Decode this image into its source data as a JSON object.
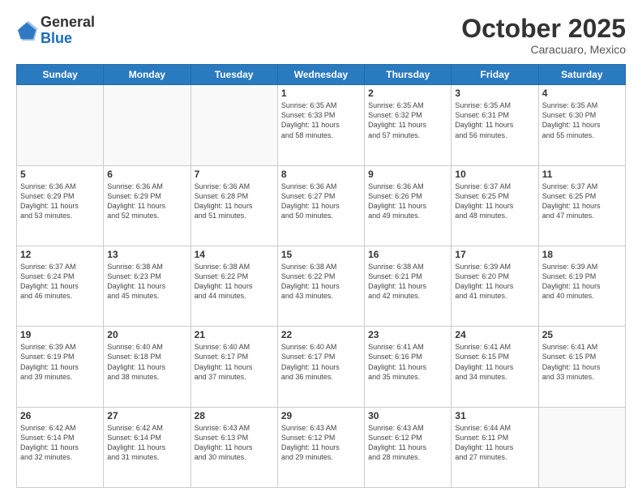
{
  "header": {
    "logo_general": "General",
    "logo_blue": "Blue",
    "month": "October 2025",
    "location": "Caracuaro, Mexico"
  },
  "days_of_week": [
    "Sunday",
    "Monday",
    "Tuesday",
    "Wednesday",
    "Thursday",
    "Friday",
    "Saturday"
  ],
  "weeks": [
    [
      {
        "day": "",
        "info": ""
      },
      {
        "day": "",
        "info": ""
      },
      {
        "day": "",
        "info": ""
      },
      {
        "day": "1",
        "info": "Sunrise: 6:35 AM\nSunset: 6:33 PM\nDaylight: 11 hours\nand 58 minutes."
      },
      {
        "day": "2",
        "info": "Sunrise: 6:35 AM\nSunset: 6:32 PM\nDaylight: 11 hours\nand 57 minutes."
      },
      {
        "day": "3",
        "info": "Sunrise: 6:35 AM\nSunset: 6:31 PM\nDaylight: 11 hours\nand 56 minutes."
      },
      {
        "day": "4",
        "info": "Sunrise: 6:35 AM\nSunset: 6:30 PM\nDaylight: 11 hours\nand 55 minutes."
      }
    ],
    [
      {
        "day": "5",
        "info": "Sunrise: 6:36 AM\nSunset: 6:29 PM\nDaylight: 11 hours\nand 53 minutes."
      },
      {
        "day": "6",
        "info": "Sunrise: 6:36 AM\nSunset: 6:29 PM\nDaylight: 11 hours\nand 52 minutes."
      },
      {
        "day": "7",
        "info": "Sunrise: 6:36 AM\nSunset: 6:28 PM\nDaylight: 11 hours\nand 51 minutes."
      },
      {
        "day": "8",
        "info": "Sunrise: 6:36 AM\nSunset: 6:27 PM\nDaylight: 11 hours\nand 50 minutes."
      },
      {
        "day": "9",
        "info": "Sunrise: 6:36 AM\nSunset: 6:26 PM\nDaylight: 11 hours\nand 49 minutes."
      },
      {
        "day": "10",
        "info": "Sunrise: 6:37 AM\nSunset: 6:25 PM\nDaylight: 11 hours\nand 48 minutes."
      },
      {
        "day": "11",
        "info": "Sunrise: 6:37 AM\nSunset: 6:25 PM\nDaylight: 11 hours\nand 47 minutes."
      }
    ],
    [
      {
        "day": "12",
        "info": "Sunrise: 6:37 AM\nSunset: 6:24 PM\nDaylight: 11 hours\nand 46 minutes."
      },
      {
        "day": "13",
        "info": "Sunrise: 6:38 AM\nSunset: 6:23 PM\nDaylight: 11 hours\nand 45 minutes."
      },
      {
        "day": "14",
        "info": "Sunrise: 6:38 AM\nSunset: 6:22 PM\nDaylight: 11 hours\nand 44 minutes."
      },
      {
        "day": "15",
        "info": "Sunrise: 6:38 AM\nSunset: 6:22 PM\nDaylight: 11 hours\nand 43 minutes."
      },
      {
        "day": "16",
        "info": "Sunrise: 6:38 AM\nSunset: 6:21 PM\nDaylight: 11 hours\nand 42 minutes."
      },
      {
        "day": "17",
        "info": "Sunrise: 6:39 AM\nSunset: 6:20 PM\nDaylight: 11 hours\nand 41 minutes."
      },
      {
        "day": "18",
        "info": "Sunrise: 6:39 AM\nSunset: 6:19 PM\nDaylight: 11 hours\nand 40 minutes."
      }
    ],
    [
      {
        "day": "19",
        "info": "Sunrise: 6:39 AM\nSunset: 6:19 PM\nDaylight: 11 hours\nand 39 minutes."
      },
      {
        "day": "20",
        "info": "Sunrise: 6:40 AM\nSunset: 6:18 PM\nDaylight: 11 hours\nand 38 minutes."
      },
      {
        "day": "21",
        "info": "Sunrise: 6:40 AM\nSunset: 6:17 PM\nDaylight: 11 hours\nand 37 minutes."
      },
      {
        "day": "22",
        "info": "Sunrise: 6:40 AM\nSunset: 6:17 PM\nDaylight: 11 hours\nand 36 minutes."
      },
      {
        "day": "23",
        "info": "Sunrise: 6:41 AM\nSunset: 6:16 PM\nDaylight: 11 hours\nand 35 minutes."
      },
      {
        "day": "24",
        "info": "Sunrise: 6:41 AM\nSunset: 6:15 PM\nDaylight: 11 hours\nand 34 minutes."
      },
      {
        "day": "25",
        "info": "Sunrise: 6:41 AM\nSunset: 6:15 PM\nDaylight: 11 hours\nand 33 minutes."
      }
    ],
    [
      {
        "day": "26",
        "info": "Sunrise: 6:42 AM\nSunset: 6:14 PM\nDaylight: 11 hours\nand 32 minutes."
      },
      {
        "day": "27",
        "info": "Sunrise: 6:42 AM\nSunset: 6:14 PM\nDaylight: 11 hours\nand 31 minutes."
      },
      {
        "day": "28",
        "info": "Sunrise: 6:43 AM\nSunset: 6:13 PM\nDaylight: 11 hours\nand 30 minutes."
      },
      {
        "day": "29",
        "info": "Sunrise: 6:43 AM\nSunset: 6:12 PM\nDaylight: 11 hours\nand 29 minutes."
      },
      {
        "day": "30",
        "info": "Sunrise: 6:43 AM\nSunset: 6:12 PM\nDaylight: 11 hours\nand 28 minutes."
      },
      {
        "day": "31",
        "info": "Sunrise: 6:44 AM\nSunset: 6:11 PM\nDaylight: 11 hours\nand 27 minutes."
      },
      {
        "day": "",
        "info": ""
      }
    ]
  ]
}
